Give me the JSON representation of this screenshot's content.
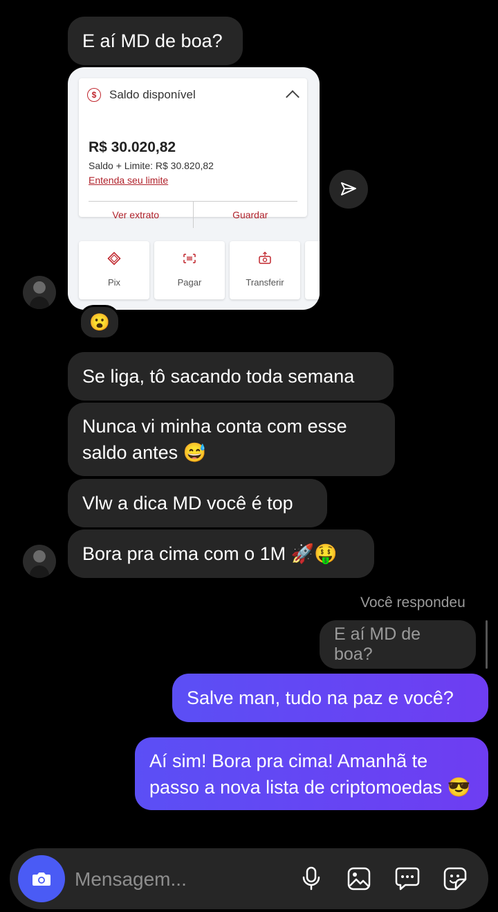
{
  "messages": {
    "m1": "E aí MD de boa?",
    "m2": "Se liga, tô sacando toda semana",
    "m3": "Nunca vi minha conta com esse saldo antes 😅",
    "m4": "Vlw a dica MD você é top",
    "m5": "Bora pra cima com o 1M 🚀🤑",
    "reaction": "😮"
  },
  "card": {
    "title": "Saldo disponível",
    "amount": "R$ 30.020,82",
    "limit": "Saldo + Limite: R$ 30.820,82",
    "link": "Entenda seu limite",
    "btn_extract": "Ver extrato",
    "btn_save": "Guardar",
    "actions": [
      "Pix",
      "Pagar",
      "Transferir"
    ],
    "accent_color": "#c0262d"
  },
  "reply": {
    "label": "Você respondeu",
    "quoted": "E aí MD de boa?"
  },
  "outgoing": {
    "o1": "Salve man, tudo na paz e você?",
    "o2": "Aí sim! Bora pra cima! Amanhã te passo a nova lista de criptomoedas 😎"
  },
  "composer": {
    "placeholder": "Mensagem..."
  },
  "icons": [
    "camera-icon",
    "microphone-icon",
    "gallery-icon",
    "chat-options-icon",
    "sticker-icon",
    "send-icon"
  ],
  "colors": {
    "outgoing": "#5b4ff5",
    "camera_button": "#4a5bf5",
    "incoming": "#262626"
  }
}
